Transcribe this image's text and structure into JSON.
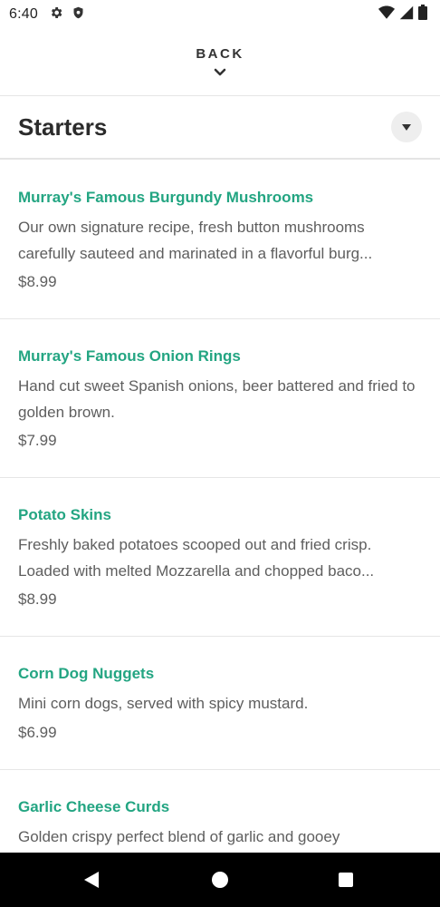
{
  "status_bar": {
    "time": "6:40",
    "left_icons": [
      "gear-icon",
      "shield-icon"
    ],
    "right_icons": [
      "wifi-icon",
      "signal-icon",
      "battery-icon"
    ]
  },
  "header": {
    "back_label": "BACK"
  },
  "section": {
    "title": "Starters"
  },
  "menu_items": [
    {
      "name": "Murray's Famous Burgundy Mushrooms",
      "description": "Our own signature recipe, fresh button mushrooms carefully sauteed and marinated in a flavorful burg...",
      "price": "$8.99"
    },
    {
      "name": "Murray's Famous Onion Rings",
      "description": "Hand cut sweet Spanish onions, beer battered and fried to golden brown.",
      "price": "$7.99"
    },
    {
      "name": "Potato Skins",
      "description": "Freshly baked potatoes scooped out and fried crisp. Loaded with melted Mozzarella and chopped baco...",
      "price": "$8.99"
    },
    {
      "name": "Corn Dog Nuggets",
      "description": "Mini corn dogs, served with spicy mustard.",
      "price": "$6.99"
    },
    {
      "name": "Garlic Cheese Curds",
      "description": "Golden crispy perfect blend of garlic and gooey",
      "price": ""
    }
  ],
  "nav_bar": {
    "buttons": [
      "back-triangle-icon",
      "home-circle-icon",
      "recents-square-icon"
    ]
  },
  "colors": {
    "accent": "#23a582",
    "text": "#5e5e5e",
    "title": "#2b2b2b",
    "nav_background": "#000000"
  }
}
